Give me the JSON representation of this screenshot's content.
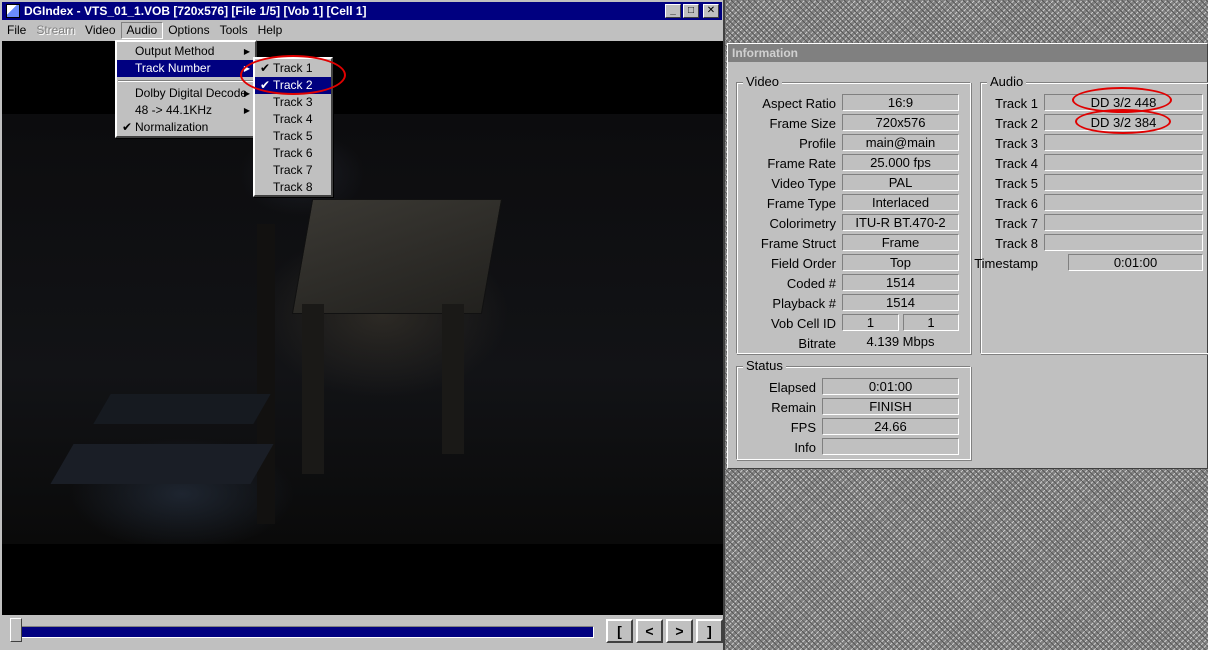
{
  "main_window": {
    "title": "DGIndex - VTS_01_1.VOB [720x576] [File 1/5] [Vob 1] [Cell 1]",
    "title_buttons": {
      "minimize": "_",
      "maximize": "□",
      "close": "✕"
    },
    "menu": [
      "File",
      "Stream",
      "Video",
      "Audio",
      "Options",
      "Tools",
      "Help"
    ],
    "nav_buttons": [
      "[",
      "<",
      ">",
      "]"
    ]
  },
  "audio_menu": {
    "items": [
      {
        "label": "Output Method",
        "arrow": "▶"
      },
      {
        "label": "Track Number",
        "arrow": "▶"
      },
      {
        "label": "Dolby Digital Decode",
        "arrow": "▶"
      },
      {
        "label": "48 -> 44.1KHz",
        "arrow": "▶"
      },
      {
        "label": "Normalization",
        "check": "✔"
      }
    ]
  },
  "track_menu": {
    "items": [
      "Track 1",
      "Track 2",
      "Track 3",
      "Track 4",
      "Track 5",
      "Track 6",
      "Track 7",
      "Track 8"
    ],
    "check": "✔"
  },
  "info_window": {
    "title": "Information",
    "video": {
      "title": "Video",
      "labels": [
        "Aspect Ratio",
        "Frame Size",
        "Profile",
        "Frame Rate",
        "Video Type",
        "Frame Type",
        "Colorimetry",
        "Frame Struct",
        "Field Order",
        "Coded #",
        "Playback #",
        "Vob Cell ID",
        "Bitrate"
      ],
      "values": [
        "16:9",
        "720x576",
        "main@main",
        "25.000 fps",
        "PAL",
        "Interlaced",
        "ITU-R BT.470-2",
        "Frame",
        "Top",
        "1514",
        "1514",
        "1",
        "4.139 Mbps"
      ],
      "vob_cell_second": "1"
    },
    "audio": {
      "title": "Audio",
      "labels": [
        "Track 1",
        "Track 2",
        "Track 3",
        "Track 4",
        "Track 5",
        "Track 6",
        "Track 7",
        "Track 8",
        "Timestamp"
      ],
      "values": [
        "DD 3/2 448",
        "DD 3/2 384",
        "",
        "",
        "",
        "",
        "",
        "",
        "0:01:00"
      ]
    },
    "status": {
      "title": "Status",
      "labels": [
        "Elapsed",
        "Remain",
        "FPS",
        "Info"
      ],
      "values": [
        "0:01:00",
        "FINISH",
        "24.66",
        ""
      ]
    }
  },
  "colors": {
    "title_active": "#000080",
    "title_inactive": "#808080",
    "highlight": "#000080",
    "annotation": "#e00000",
    "face": "#c0c0c0"
  }
}
